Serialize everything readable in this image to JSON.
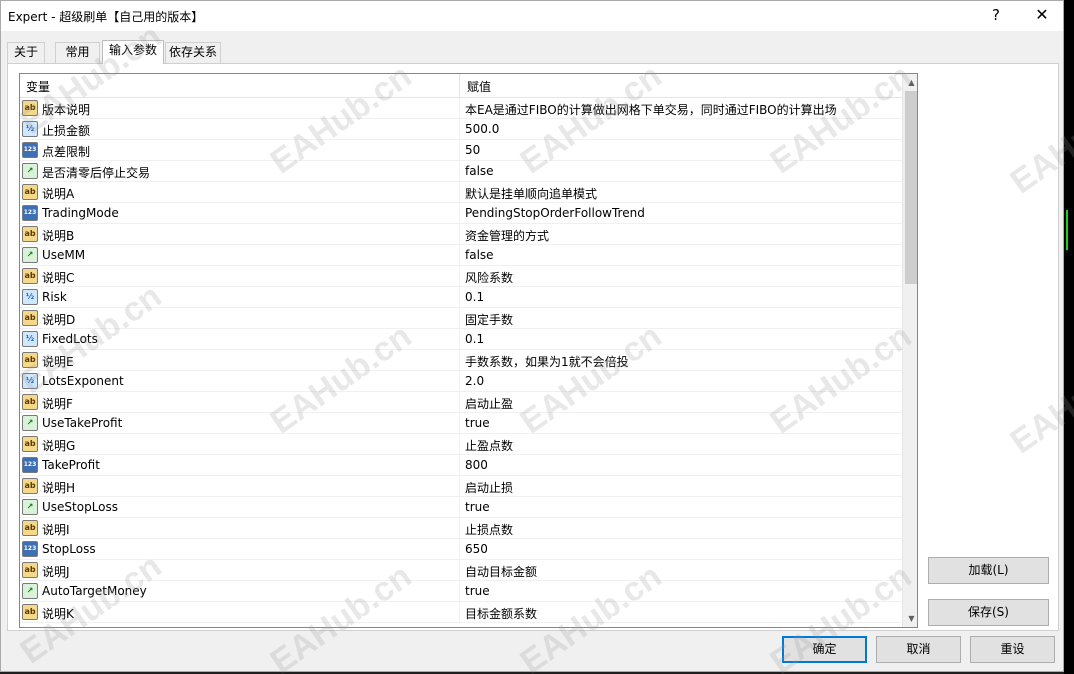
{
  "window": {
    "title": "Expert - 超级刷单【自己用的版本】",
    "help_glyph": "?",
    "close_glyph": "✕"
  },
  "tabs": [
    "关于",
    "常用",
    "输入参数",
    "依存关系"
  ],
  "active_tab": "输入参数",
  "grid": {
    "col_variable": "变量",
    "col_value": "赋值",
    "rows": [
      {
        "icon": "ab",
        "variable": "版本说明",
        "value": "本EA是通过FIBO的计算做出网格下单交易，同时通过FIBO的计算出场"
      },
      {
        "icon": "v2",
        "variable": "止损金额",
        "value": "500.0"
      },
      {
        "icon": "123",
        "variable": "点差限制",
        "value": "50"
      },
      {
        "icon": "bool",
        "variable": "是否清零后停止交易",
        "value": "false"
      },
      {
        "icon": "ab",
        "variable": "说明A",
        "value": "默认是挂单顺向追单模式"
      },
      {
        "icon": "123",
        "variable": "TradingMode",
        "value": "PendingStopOrderFollowTrend"
      },
      {
        "icon": "ab",
        "variable": "说明B",
        "value": "资金管理的方式"
      },
      {
        "icon": "bool",
        "variable": "UseMM",
        "value": "false"
      },
      {
        "icon": "ab",
        "variable": "说明C",
        "value": "风险系数"
      },
      {
        "icon": "v2",
        "variable": "Risk",
        "value": "0.1"
      },
      {
        "icon": "ab",
        "variable": "说明D",
        "value": "固定手数"
      },
      {
        "icon": "v2",
        "variable": "FixedLots",
        "value": "0.1"
      },
      {
        "icon": "ab",
        "variable": "说明E",
        "value": "手数系数，如果为1就不会倍投"
      },
      {
        "icon": "v2",
        "variable": "LotsExponent",
        "value": "2.0"
      },
      {
        "icon": "ab",
        "variable": "说明F",
        "value": "启动止盈"
      },
      {
        "icon": "bool",
        "variable": "UseTakeProfit",
        "value": "true"
      },
      {
        "icon": "ab",
        "variable": "说明G",
        "value": "止盈点数"
      },
      {
        "icon": "123",
        "variable": "TakeProfit",
        "value": "800"
      },
      {
        "icon": "ab",
        "variable": "说明H",
        "value": "启动止损"
      },
      {
        "icon": "bool",
        "variable": "UseStopLoss",
        "value": "true"
      },
      {
        "icon": "ab",
        "variable": "说明I",
        "value": "止损点数"
      },
      {
        "icon": "123",
        "variable": "StopLoss",
        "value": "650"
      },
      {
        "icon": "ab",
        "variable": "说明J",
        "value": "自动目标金额"
      },
      {
        "icon": "bool",
        "variable": "AutoTargetMoney",
        "value": "true"
      },
      {
        "icon": "ab",
        "variable": "说明K",
        "value": "目标金额系数"
      }
    ]
  },
  "icon_labels": {
    "ab": "ab",
    "v2": "½",
    "123": "123",
    "bool": "↗"
  },
  "buttons": {
    "load": "加载(L)",
    "save": "保存(S)",
    "ok": "确定",
    "cancel": "取消",
    "reset": "重设"
  },
  "scrollbar": {
    "up_glyph": "▲",
    "down_glyph": "▼"
  },
  "watermark_text": "EAHub.cn"
}
